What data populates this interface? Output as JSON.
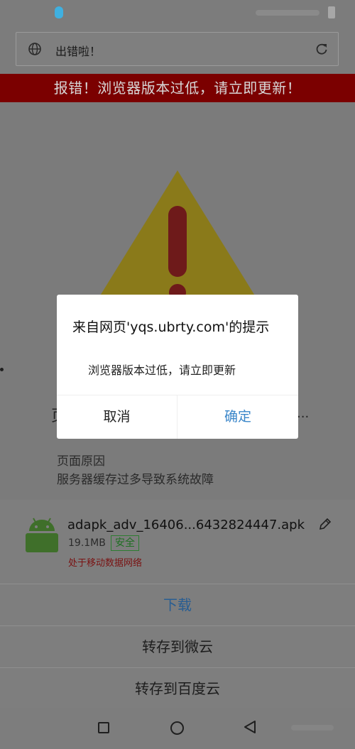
{
  "address_bar": {
    "title": "出错啦！"
  },
  "banner": {
    "text": "报错！浏览器版本过低，请立即更新！"
  },
  "page": {
    "peek_left": "页",
    "peek_right": "...",
    "reason_title": "页面原因",
    "reason_text": "服务器缓存过多导致系统故障"
  },
  "dialog": {
    "title": "来自网页'yqs.ubrty.com'的提示",
    "message": "浏览器版本过低，请立即更新",
    "cancel_label": "取消",
    "ok_label": "确定"
  },
  "download": {
    "file_name": "adapk_adv_16406...6432824447.apk",
    "file_size": "19.1MB",
    "safe_badge": "安全",
    "network_note": "处于移动数据网络",
    "options": {
      "download": "下载",
      "save_weiyun": "转存到微云",
      "save_baidu": "转存到百度云"
    }
  },
  "colors": {
    "banner_bg": "#7b0000",
    "ok_blue": "#3a86c9",
    "android_green": "#3f6f2a",
    "warning_yellow": "#8a7a1a",
    "warning_red": "#6e1a1a"
  },
  "icons": [
    "globe-icon",
    "reload-icon",
    "warning-icon",
    "android-icon",
    "edit-icon",
    "recent-apps-icon",
    "home-icon",
    "back-icon"
  ]
}
